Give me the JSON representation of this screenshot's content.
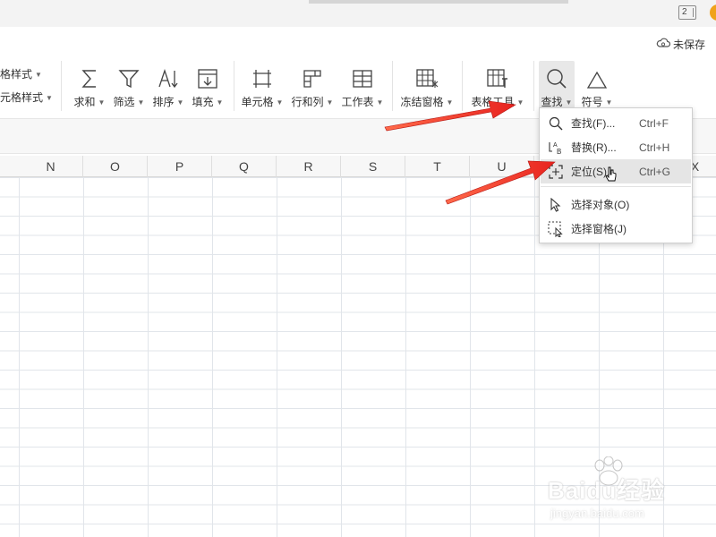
{
  "title_bar": {
    "window_count": "2"
  },
  "save_status": {
    "label": "未保存"
  },
  "ribbon": {
    "left_partial": {
      "line1": "格样式",
      "line2": "元格样式"
    },
    "tools": {
      "sum": "求和",
      "filter": "筛选",
      "sort": "排序",
      "fill": "填充",
      "cell": "单元格",
      "rows_cols": "行和列",
      "worksheet": "工作表",
      "freeze": "冻结窗格",
      "table_tools": "表格工具",
      "find": "查找",
      "symbol": "符号"
    }
  },
  "columns": [
    "N",
    "O",
    "P",
    "Q",
    "R",
    "S",
    "T",
    "U",
    "X"
  ],
  "dropdown": {
    "items": [
      {
        "icon": "magnifier-icon",
        "label": "查找(F)...",
        "shortcut": "Ctrl+F"
      },
      {
        "icon": "replace-icon",
        "label": "替换(R)...",
        "shortcut": "Ctrl+H"
      },
      {
        "icon": "locate-icon",
        "label": "定位(S)...",
        "shortcut": "Ctrl+G",
        "highlighted": true
      },
      {
        "icon": "select-object-icon",
        "label": "选择对象(O)",
        "shortcut": ""
      },
      {
        "icon": "select-pane-icon",
        "label": "选择窗格(J)",
        "shortcut": ""
      }
    ]
  },
  "annotations": {
    "arrow_color": "#e8231f"
  },
  "watermark": {
    "text": "Baidu经验",
    "sub": "jingyan.baidu.com"
  }
}
